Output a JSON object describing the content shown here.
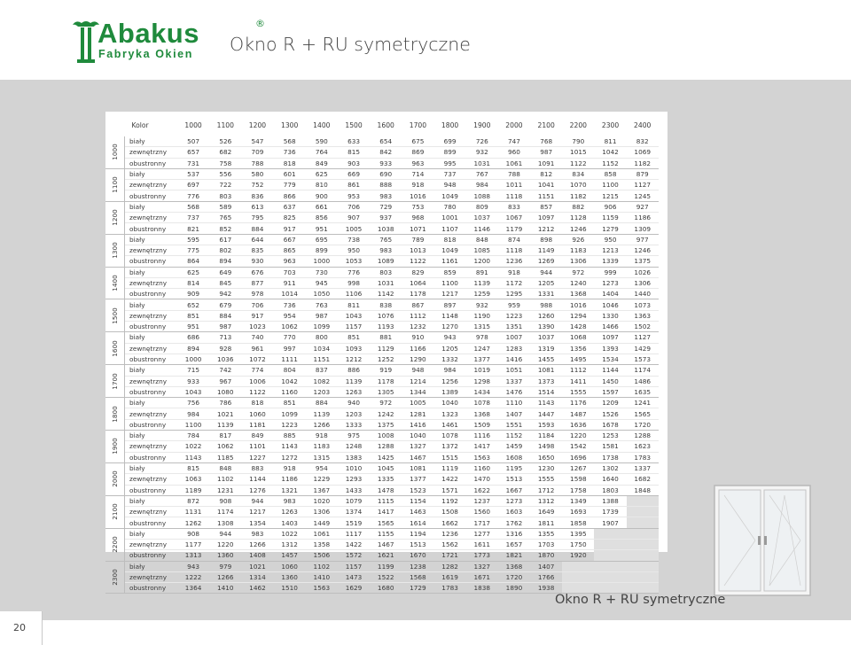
{
  "brand": {
    "name": "Abakus",
    "subtitle": "Fabryka Okien",
    "registered": "®",
    "color": "#1f8a3c"
  },
  "page_title": "Okno R + RU symetryczne",
  "footer_title": "Okno R + RU symetryczne",
  "page_number": "20",
  "table": {
    "colour_header": "Kolor",
    "widths": [
      "1000",
      "1100",
      "1200",
      "1300",
      "1400",
      "1500",
      "1600",
      "1700",
      "1800",
      "1900",
      "2000",
      "2100",
      "2200",
      "2300",
      "2400"
    ],
    "colours": [
      "biały",
      "zewnętrzny",
      "obustronny"
    ],
    "groups": [
      {
        "height": "1000",
        "rows": [
          [
            "507",
            "526",
            "547",
            "568",
            "590",
            "633",
            "654",
            "675",
            "699",
            "726",
            "747",
            "768",
            "790",
            "811",
            "832"
          ],
          [
            "657",
            "682",
            "709",
            "736",
            "764",
            "815",
            "842",
            "869",
            "899",
            "932",
            "960",
            "987",
            "1015",
            "1042",
            "1069"
          ],
          [
            "731",
            "758",
            "788",
            "818",
            "849",
            "903",
            "933",
            "963",
            "995",
            "1031",
            "1061",
            "1091",
            "1122",
            "1152",
            "1182"
          ]
        ]
      },
      {
        "height": "1100",
        "rows": [
          [
            "537",
            "556",
            "580",
            "601",
            "625",
            "669",
            "690",
            "714",
            "737",
            "767",
            "788",
            "812",
            "834",
            "858",
            "879"
          ],
          [
            "697",
            "722",
            "752",
            "779",
            "810",
            "861",
            "888",
            "918",
            "948",
            "984",
            "1011",
            "1041",
            "1070",
            "1100",
            "1127"
          ],
          [
            "776",
            "803",
            "836",
            "866",
            "900",
            "953",
            "983",
            "1016",
            "1049",
            "1088",
            "1118",
            "1151",
            "1182",
            "1215",
            "1245"
          ]
        ]
      },
      {
        "height": "1200",
        "rows": [
          [
            "568",
            "589",
            "613",
            "637",
            "661",
            "706",
            "729",
            "753",
            "780",
            "809",
            "833",
            "857",
            "882",
            "906",
            "927"
          ],
          [
            "737",
            "765",
            "795",
            "825",
            "856",
            "907",
            "937",
            "968",
            "1001",
            "1037",
            "1067",
            "1097",
            "1128",
            "1159",
            "1186"
          ],
          [
            "821",
            "852",
            "884",
            "917",
            "951",
            "1005",
            "1038",
            "1071",
            "1107",
            "1146",
            "1179",
            "1212",
            "1246",
            "1279",
            "1309"
          ]
        ]
      },
      {
        "height": "1300",
        "rows": [
          [
            "595",
            "617",
            "644",
            "667",
            "695",
            "738",
            "765",
            "789",
            "818",
            "848",
            "874",
            "898",
            "926",
            "950",
            "977"
          ],
          [
            "775",
            "802",
            "835",
            "865",
            "899",
            "950",
            "983",
            "1013",
            "1049",
            "1085",
            "1118",
            "1149",
            "1183",
            "1213",
            "1246"
          ],
          [
            "864",
            "894",
            "930",
            "963",
            "1000",
            "1053",
            "1089",
            "1122",
            "1161",
            "1200",
            "1236",
            "1269",
            "1306",
            "1339",
            "1375"
          ]
        ]
      },
      {
        "height": "1400",
        "rows": [
          [
            "625",
            "649",
            "676",
            "703",
            "730",
            "776",
            "803",
            "829",
            "859",
            "891",
            "918",
            "944",
            "972",
            "999",
            "1026"
          ],
          [
            "814",
            "845",
            "877",
            "911",
            "945",
            "998",
            "1031",
            "1064",
            "1100",
            "1139",
            "1172",
            "1205",
            "1240",
            "1273",
            "1306"
          ],
          [
            "909",
            "942",
            "978",
            "1014",
            "1050",
            "1106",
            "1142",
            "1178",
            "1217",
            "1259",
            "1295",
            "1331",
            "1368",
            "1404",
            "1440"
          ]
        ]
      },
      {
        "height": "1500",
        "rows": [
          [
            "652",
            "679",
            "706",
            "736",
            "763",
            "811",
            "838",
            "867",
            "897",
            "932",
            "959",
            "988",
            "1016",
            "1046",
            "1073"
          ],
          [
            "851",
            "884",
            "917",
            "954",
            "987",
            "1043",
            "1076",
            "1112",
            "1148",
            "1190",
            "1223",
            "1260",
            "1294",
            "1330",
            "1363"
          ],
          [
            "951",
            "987",
            "1023",
            "1062",
            "1099",
            "1157",
            "1193",
            "1232",
            "1270",
            "1315",
            "1351",
            "1390",
            "1428",
            "1466",
            "1502"
          ]
        ]
      },
      {
        "height": "1600",
        "rows": [
          [
            "686",
            "713",
            "740",
            "770",
            "800",
            "851",
            "881",
            "910",
            "943",
            "978",
            "1007",
            "1037",
            "1068",
            "1097",
            "1127"
          ],
          [
            "894",
            "928",
            "961",
            "997",
            "1034",
            "1093",
            "1129",
            "1166",
            "1205",
            "1247",
            "1283",
            "1319",
            "1356",
            "1393",
            "1429"
          ],
          [
            "1000",
            "1036",
            "1072",
            "1111",
            "1151",
            "1212",
            "1252",
            "1290",
            "1332",
            "1377",
            "1416",
            "1455",
            "1495",
            "1534",
            "1573"
          ]
        ]
      },
      {
        "height": "1700",
        "rows": [
          [
            "715",
            "742",
            "774",
            "804",
            "837",
            "886",
            "919",
            "948",
            "984",
            "1019",
            "1051",
            "1081",
            "1112",
            "1144",
            "1174"
          ],
          [
            "933",
            "967",
            "1006",
            "1042",
            "1082",
            "1139",
            "1178",
            "1214",
            "1256",
            "1298",
            "1337",
            "1373",
            "1411",
            "1450",
            "1486"
          ],
          [
            "1043",
            "1080",
            "1122",
            "1160",
            "1203",
            "1263",
            "1305",
            "1344",
            "1389",
            "1434",
            "1476",
            "1514",
            "1555",
            "1597",
            "1635"
          ]
        ]
      },
      {
        "height": "1800",
        "rows": [
          [
            "756",
            "786",
            "818",
            "851",
            "884",
            "940",
            "972",
            "1005",
            "1040",
            "1078",
            "1110",
            "1143",
            "1176",
            "1209",
            "1241"
          ],
          [
            "984",
            "1021",
            "1060",
            "1099",
            "1139",
            "1203",
            "1242",
            "1281",
            "1323",
            "1368",
            "1407",
            "1447",
            "1487",
            "1526",
            "1565"
          ],
          [
            "1100",
            "1139",
            "1181",
            "1223",
            "1266",
            "1333",
            "1375",
            "1416",
            "1461",
            "1509",
            "1551",
            "1593",
            "1636",
            "1678",
            "1720"
          ]
        ]
      },
      {
        "height": "1900",
        "rows": [
          [
            "784",
            "817",
            "849",
            "885",
            "918",
            "975",
            "1008",
            "1040",
            "1078",
            "1116",
            "1152",
            "1184",
            "1220",
            "1253",
            "1288"
          ],
          [
            "1022",
            "1062",
            "1101",
            "1143",
            "1183",
            "1248",
            "1288",
            "1327",
            "1372",
            "1417",
            "1459",
            "1498",
            "1542",
            "1581",
            "1623"
          ],
          [
            "1143",
            "1185",
            "1227",
            "1272",
            "1315",
            "1383",
            "1425",
            "1467",
            "1515",
            "1563",
            "1608",
            "1650",
            "1696",
            "1738",
            "1783"
          ]
        ]
      },
      {
        "height": "2000",
        "rows": [
          [
            "815",
            "848",
            "883",
            "918",
            "954",
            "1010",
            "1045",
            "1081",
            "1119",
            "1160",
            "1195",
            "1230",
            "1267",
            "1302",
            "1337"
          ],
          [
            "1063",
            "1102",
            "1144",
            "1186",
            "1229",
            "1293",
            "1335",
            "1377",
            "1422",
            "1470",
            "1513",
            "1555",
            "1598",
            "1640",
            "1682"
          ],
          [
            "1189",
            "1231",
            "1276",
            "1321",
            "1367",
            "1433",
            "1478",
            "1523",
            "1571",
            "1622",
            "1667",
            "1712",
            "1758",
            "1803",
            "1848"
          ]
        ]
      },
      {
        "height": "2100",
        "rows": [
          [
            "872",
            "908",
            "944",
            "983",
            "1020",
            "1079",
            "1115",
            "1154",
            "1192",
            "1237",
            "1273",
            "1312",
            "1349",
            "1388",
            ""
          ],
          [
            "1131",
            "1174",
            "1217",
            "1263",
            "1306",
            "1374",
            "1417",
            "1463",
            "1508",
            "1560",
            "1603",
            "1649",
            "1693",
            "1739",
            ""
          ],
          [
            "1262",
            "1308",
            "1354",
            "1403",
            "1449",
            "1519",
            "1565",
            "1614",
            "1662",
            "1717",
            "1762",
            "1811",
            "1858",
            "1907",
            ""
          ]
        ]
      },
      {
        "height": "2200",
        "rows": [
          [
            "908",
            "944",
            "983",
            "1022",
            "1061",
            "1117",
            "1155",
            "1194",
            "1236",
            "1277",
            "1316",
            "1355",
            "1395",
            "",
            ""
          ],
          [
            "1177",
            "1220",
            "1266",
            "1312",
            "1358",
            "1422",
            "1467",
            "1513",
            "1562",
            "1611",
            "1657",
            "1703",
            "1750",
            "",
            ""
          ],
          [
            "1313",
            "1360",
            "1408",
            "1457",
            "1506",
            "1572",
            "1621",
            "1670",
            "1721",
            "1773",
            "1821",
            "1870",
            "1920",
            "",
            ""
          ]
        ]
      },
      {
        "height": "2300",
        "rows": [
          [
            "943",
            "979",
            "1021",
            "1060",
            "1102",
            "1157",
            "1199",
            "1238",
            "1282",
            "1327",
            "1368",
            "1407",
            "",
            "",
            ""
          ],
          [
            "1222",
            "1266",
            "1314",
            "1360",
            "1410",
            "1473",
            "1522",
            "1568",
            "1619",
            "1671",
            "1720",
            "1766",
            "",
            "",
            ""
          ],
          [
            "1364",
            "1410",
            "1462",
            "1510",
            "1563",
            "1629",
            "1680",
            "1729",
            "1783",
            "1838",
            "1890",
            "1938",
            "",
            "",
            ""
          ]
        ]
      }
    ]
  }
}
